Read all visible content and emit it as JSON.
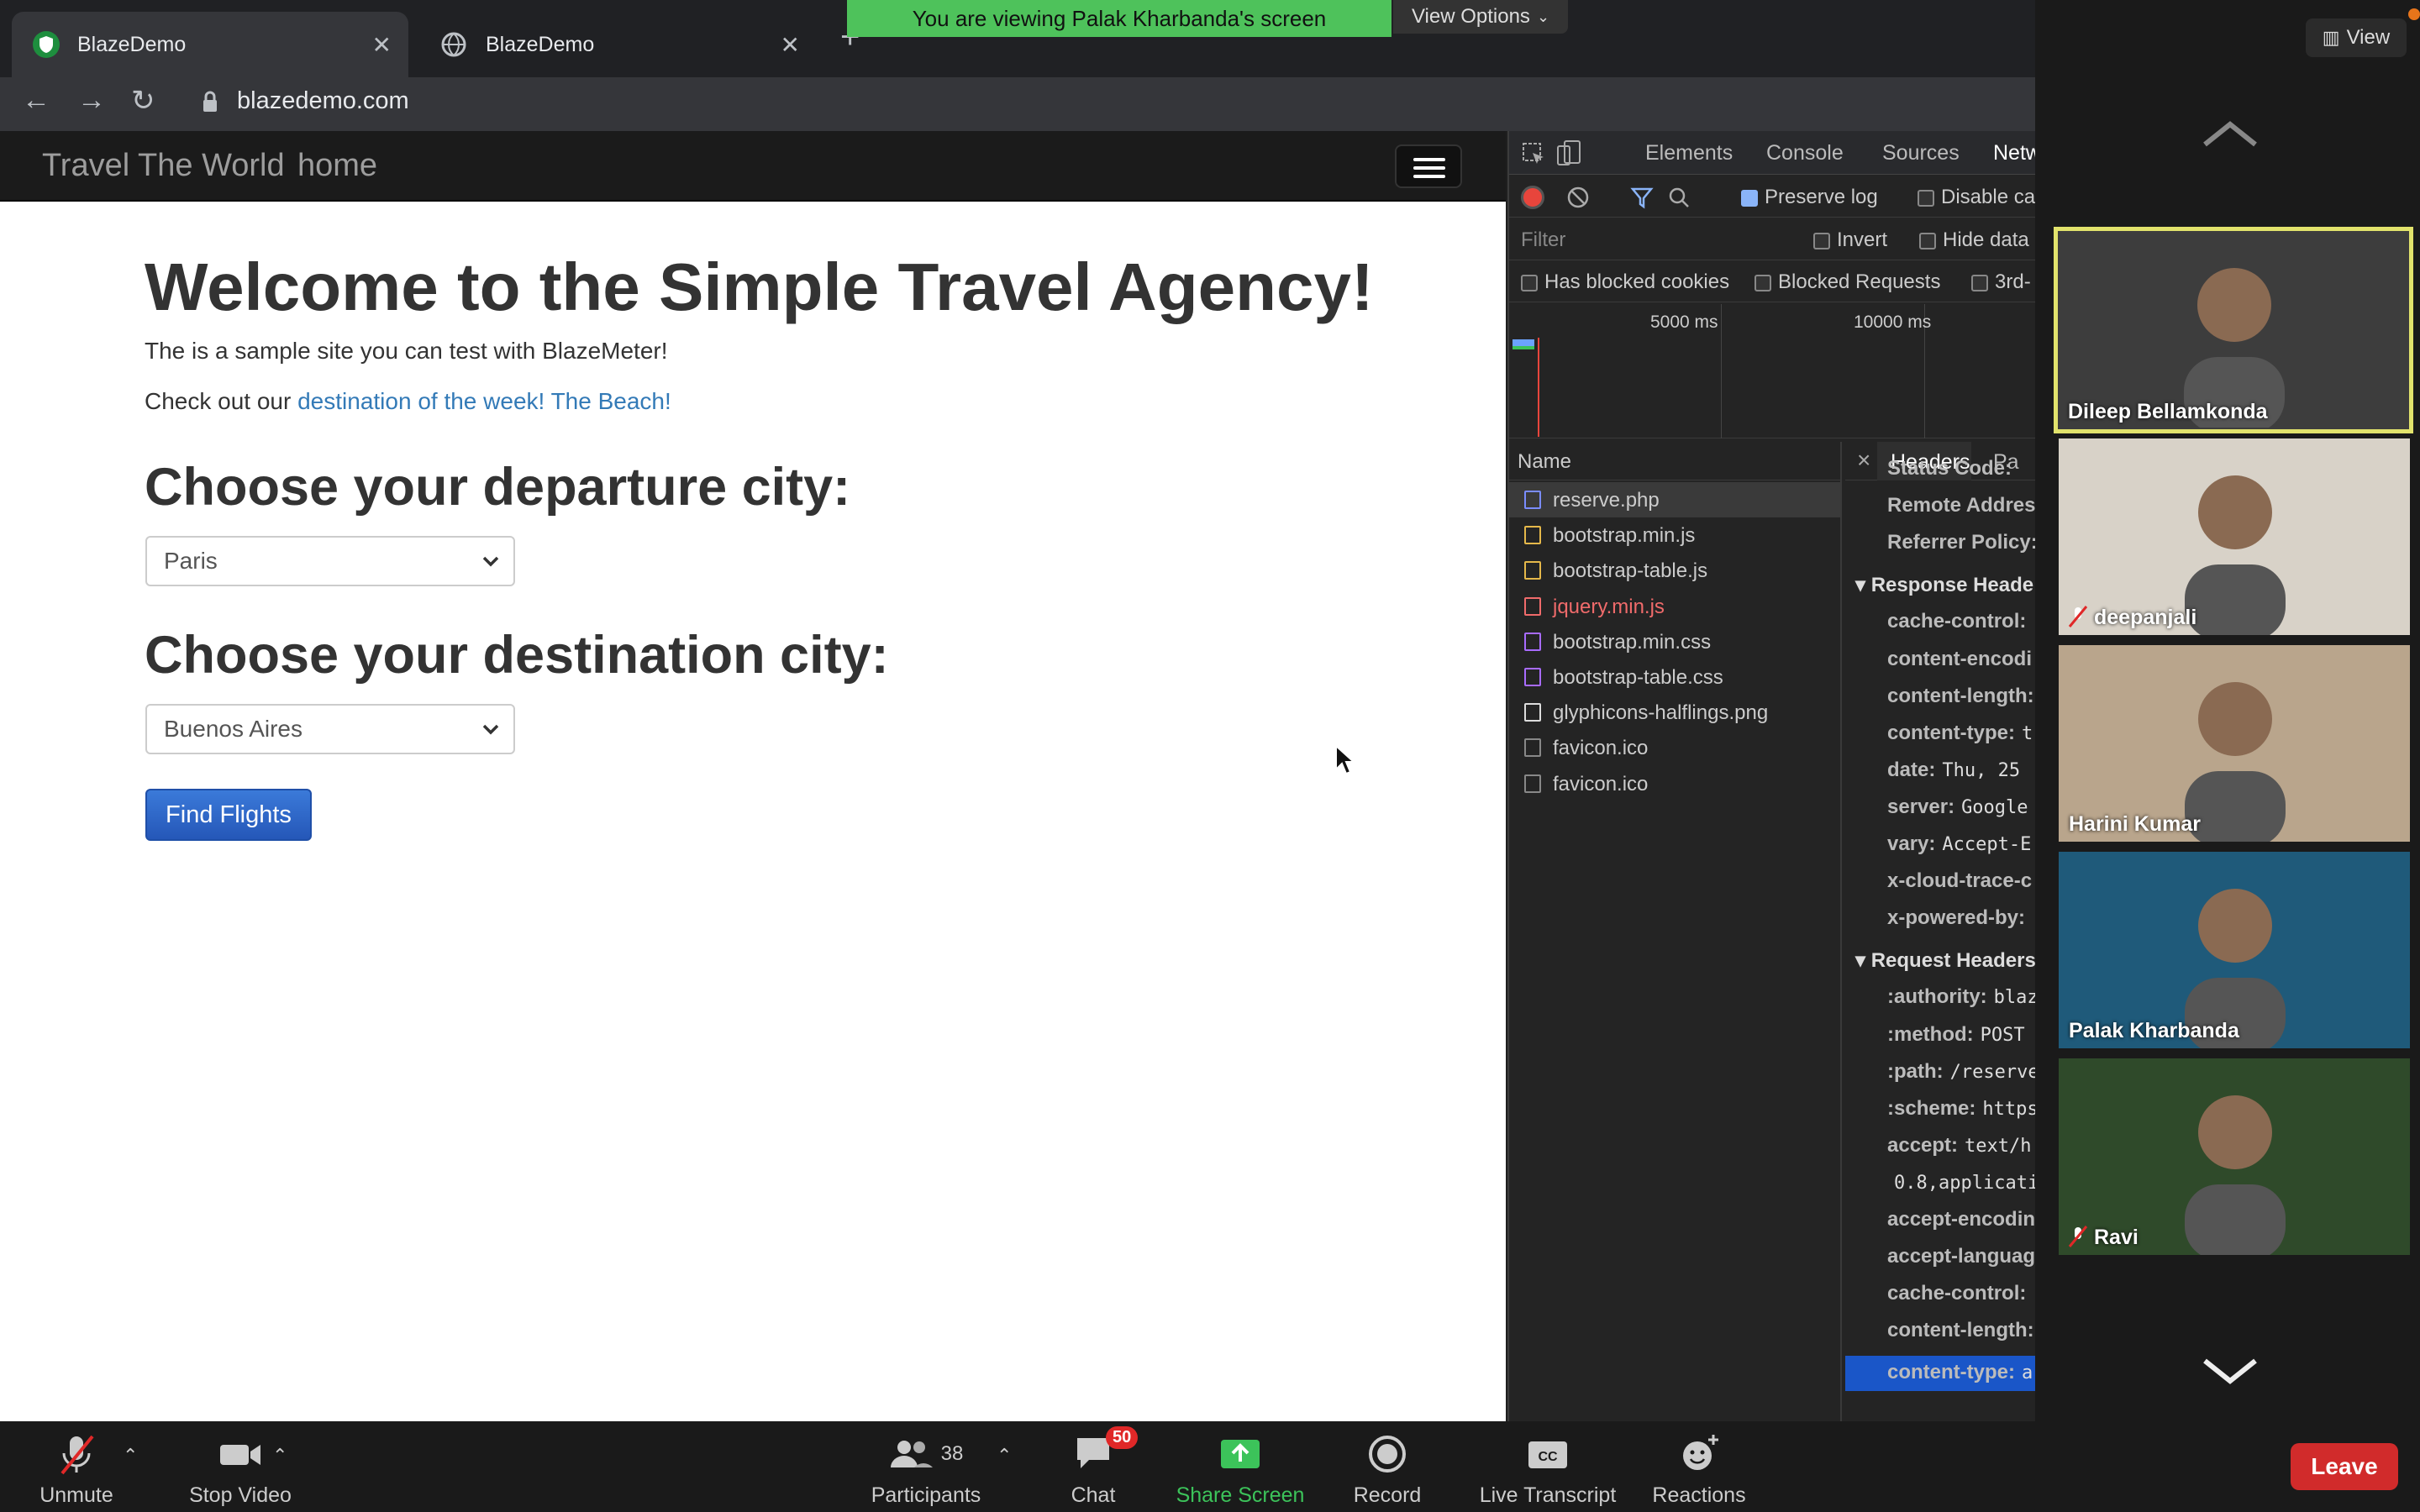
{
  "browser": {
    "tabs": [
      {
        "label": "BlazeDemo",
        "close": "✕"
      },
      {
        "label": "BlazeDemo",
        "close": "✕"
      }
    ],
    "new_tab": "+",
    "url": "blazedemo.com"
  },
  "share_banner": {
    "text": "You are viewing Palak Kharbanda's screen",
    "view_options": "View Options"
  },
  "page": {
    "brand": "Travel The World",
    "home_link": "home",
    "title": "Welcome to the Simple Travel Agency!",
    "intro": "The is a sample site you can test with BlazeMeter!",
    "check_prefix": "Check out our",
    "check_link": "destination of the week! The Beach!",
    "departure_heading": "Choose your departure city:",
    "departure_value": "Paris",
    "destination_heading": "Choose your destination city:",
    "destination_value": "Buenos Aires",
    "find_button": "Find Flights"
  },
  "devtools": {
    "tabs": [
      "Elements",
      "Console",
      "Sources",
      "Netw"
    ],
    "preserve_log": "Preserve log",
    "disable_cache": "Disable ca",
    "filter_placeholder": "Filter",
    "invert": "Invert",
    "hide_data": "Hide data",
    "has_blocked_cookies": "Has blocked cookies",
    "blocked_requests": "Blocked Requests",
    "third_party": "3rd-",
    "timeline_ticks": [
      "5000 ms",
      "10000 ms"
    ],
    "list_header": "Name",
    "requests": [
      {
        "name": "reserve.php",
        "color": "#cccccc",
        "icon": "#7a8cff",
        "selected": true
      },
      {
        "name": "bootstrap.min.js",
        "color": "#cccccc",
        "icon": "#e5b84a"
      },
      {
        "name": "bootstrap-table.js",
        "color": "#cccccc",
        "icon": "#e5b84a"
      },
      {
        "name": "jquery.min.js",
        "color": "#f06b6b",
        "icon": "#f06b6b"
      },
      {
        "name": "bootstrap.min.css",
        "color": "#cccccc",
        "icon": "#a86bff"
      },
      {
        "name": "bootstrap-table.css",
        "color": "#cccccc",
        "icon": "#a86bff"
      },
      {
        "name": "glyphicons-halflings.png",
        "color": "#cccccc",
        "icon": "#dddddd"
      },
      {
        "name": "favicon.ico",
        "color": "#cccccc",
        "icon": "#888888"
      },
      {
        "name": "favicon.ico",
        "color": "#cccccc",
        "icon": "#888888"
      }
    ],
    "detail_close": "×",
    "detail_tabs": [
      "Headers",
      "Pa"
    ],
    "general_rows": [
      {
        "k": "Status Code:",
        "v": ""
      },
      {
        "k": "Remote Addres",
        "v": ""
      },
      {
        "k": "Referrer Policy:",
        "v": ""
      }
    ],
    "response_headers_title": "Response Heade",
    "response_headers": [
      {
        "k": "cache-control:",
        "v": ""
      },
      {
        "k": "content-encodi",
        "v": ""
      },
      {
        "k": "content-length:",
        "v": ""
      },
      {
        "k": "content-type:",
        "v": "t"
      },
      {
        "k": "date:",
        "v": "Thu, 25"
      },
      {
        "k": "server:",
        "v": "Google"
      },
      {
        "k": "vary:",
        "v": "Accept-E"
      },
      {
        "k": "x-cloud-trace-c",
        "v": ""
      },
      {
        "k": "x-powered-by:",
        "v": ""
      }
    ],
    "request_headers_title": "Request Headers",
    "request_headers": [
      {
        "k": ":authority:",
        "v": "blaz"
      },
      {
        "k": ":method:",
        "v": "POST"
      },
      {
        "k": ":path:",
        "v": "/reserve"
      },
      {
        "k": ":scheme:",
        "v": "https"
      },
      {
        "k": "accept:",
        "v": "text/h"
      },
      {
        "k": "",
        "v": "0.8,applicati"
      },
      {
        "k": "accept-encodin",
        "v": ""
      },
      {
        "k": "accept-languag",
        "v": ""
      },
      {
        "k": "cache-control:",
        "v": ""
      },
      {
        "k": "content-length:",
        "v": ""
      },
      {
        "k": "content-type:",
        "v": "a"
      }
    ]
  },
  "zoom": {
    "view_label": "View",
    "participants": [
      {
        "name": "Dileep Bellamkonda",
        "muted": false,
        "speaker": true,
        "bg": "#3d3d3d"
      },
      {
        "name": "deepanjali",
        "muted": true,
        "speaker": false,
        "bg": "#d8d2c8"
      },
      {
        "name": "Harini Kumar",
        "muted": false,
        "speaker": false,
        "bg": "#b9a58c"
      },
      {
        "name": "Palak Kharbanda",
        "muted": false,
        "speaker": false,
        "bg": "#1f5a7a"
      },
      {
        "name": "Ravi",
        "muted": true,
        "speaker": false,
        "bg": "#2f4a2a"
      }
    ],
    "toolbar": {
      "unmute": "Unmute",
      "stop_video": "Stop Video",
      "participants": "Participants",
      "participants_count": "38",
      "chat": "Chat",
      "chat_badge": "50",
      "share_screen": "Share Screen",
      "record": "Record",
      "live_transcript": "Live Transcript",
      "reactions": "Reactions",
      "leave": "Leave"
    },
    "share_color": "#3cc35a",
    "leave_color": "#d12b2b"
  }
}
